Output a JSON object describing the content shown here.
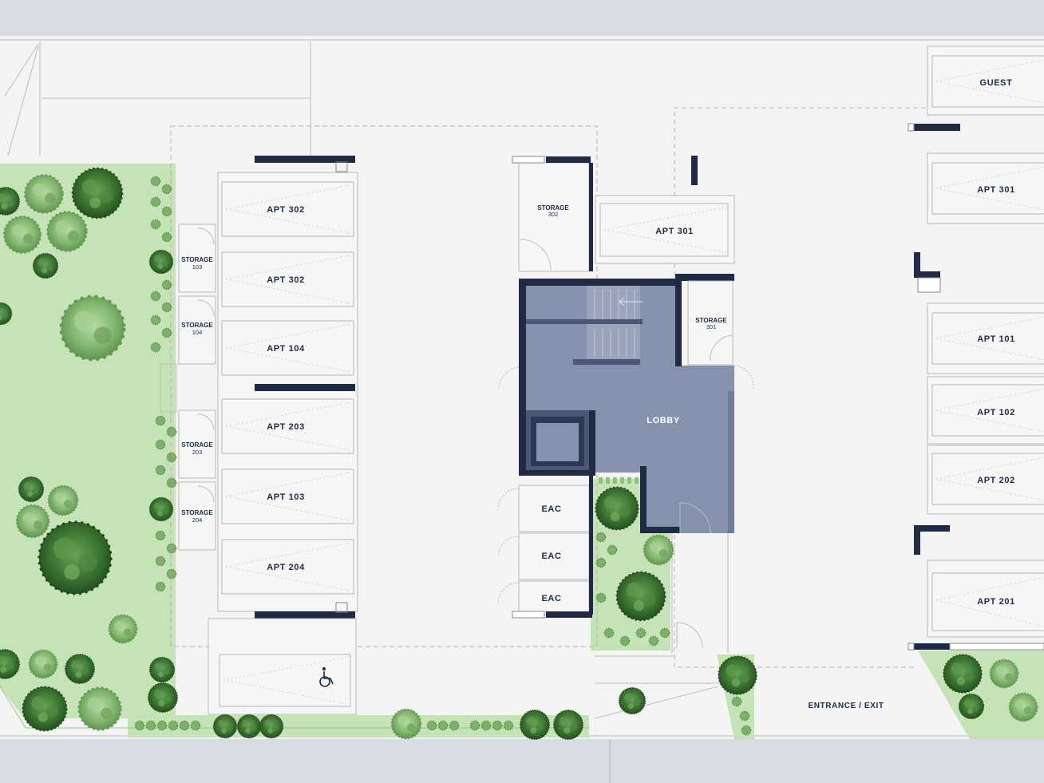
{
  "parking_east": {
    "guest": "GUEST",
    "apt_301": "APT 301",
    "apt_101": "APT 101",
    "apt_102": "APT 102",
    "apt_202": "APT 202",
    "apt_201": "APT 201"
  },
  "parking_west": {
    "row1": "APT 302",
    "row2": "APT 302",
    "row3": "APT 104",
    "row4": "APT 203",
    "row5": "APT 103",
    "row6": "APT 204"
  },
  "center": {
    "apt_301": "APT 301",
    "lobby": "LOBBY",
    "eac1": "EAC",
    "eac2": "EAC",
    "eac3": "EAC",
    "entrance": "ENTRANCE / EXIT"
  },
  "storage": {
    "word": "STORAGE",
    "s103": "103",
    "s104": "104",
    "s203": "203",
    "s204": "204",
    "s302": "302",
    "s301": "301"
  },
  "colors": {
    "lawn": "#c6e3b7",
    "lobby": "#8592ad",
    "wall": "#1f2a44",
    "road": "#d7dbe2",
    "tree_dark": "#2f5f2a",
    "tree_light": "#7fae6a"
  },
  "icons": [
    "accessible-parking-icon",
    "tree-icon",
    "shrub-icon"
  ]
}
